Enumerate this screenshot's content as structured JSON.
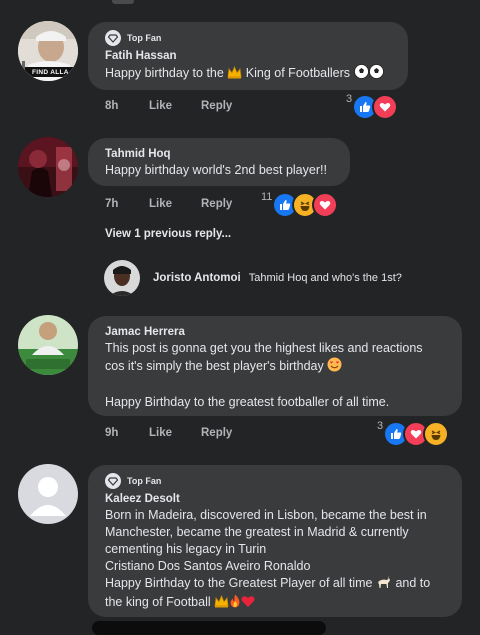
{
  "comments": [
    {
      "badge": "Top Fan",
      "author": "Fatih Hassan",
      "text": "Happy birthday to the",
      "text_after_crown": "King of Footballers",
      "avatar_caption": "FIND ALLA",
      "time": "8h",
      "like": "Like",
      "reply": "Reply",
      "reaction_count": "3",
      "reactions": [
        "like",
        "love"
      ]
    },
    {
      "author": "Tahmid Hoq",
      "text": "Happy birthday world's  2nd best player!!",
      "time": "7h",
      "like": "Like",
      "reply": "Reply",
      "reaction_count": "11",
      "reactions": [
        "like",
        "haha",
        "love"
      ],
      "view_previous": "View 1 previous reply...",
      "reply_preview": {
        "author": "Joristo Antomoi",
        "text": "Tahmid Hoq and who's the 1st?"
      }
    },
    {
      "author": "Jamac Herrera",
      "text_line1": "This post is gonna get you the highest likes and reactions",
      "text_line2": "cos it's simply the best player's birthday",
      "text_line3": "Happy Birthday to the greatest footballer of all time.",
      "time": "9h",
      "like": "Like",
      "reply": "Reply",
      "reaction_count": "3",
      "reactions": [
        "like",
        "love",
        "haha"
      ]
    },
    {
      "badge": "Top Fan",
      "author": "Kaleez Desolt",
      "line1": "Born in Madeira, discovered in Lisbon, became the best in",
      "line2": "Manchester, became the greatest in Madrid & currently",
      "line3": "cementing his legacy in Turin",
      "line4": "Cristiano Dos Santos Aveiro Ronaldo",
      "line5": "Happy Birthday to the Greatest Player of all time",
      "line5_after": "and to",
      "line6": "the king of Football"
    }
  ],
  "colors": {
    "background": "#232425",
    "bubble": "#3a3b3c",
    "text": "#e4e6eb",
    "muted": "#b0b3b8",
    "like": "#1877f2",
    "love": "#f33e58",
    "haha": "#f7b125"
  }
}
